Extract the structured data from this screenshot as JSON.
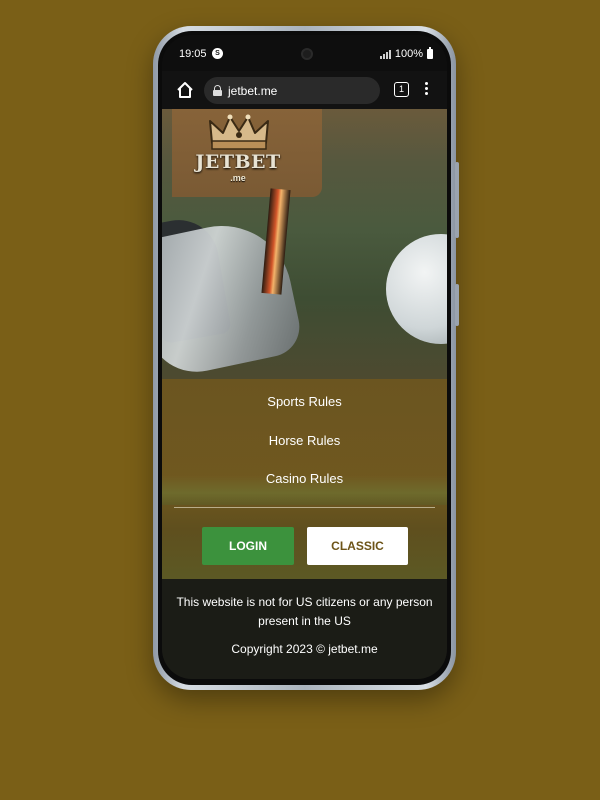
{
  "status_bar": {
    "time": "19:05",
    "notification_badge": "S",
    "battery_percent": "100%"
  },
  "browser": {
    "url": "jetbet.me",
    "tab_count": "1"
  },
  "logo": {
    "crown_text": "JETBET",
    "name": "JETBET",
    "suffix": ".me"
  },
  "menu": {
    "items": [
      {
        "label": "Sports Rules"
      },
      {
        "label": "Horse Rules"
      },
      {
        "label": "Casino Rules"
      }
    ]
  },
  "buttons": {
    "login": "LOGIN",
    "classic": "CLASSIC"
  },
  "footer": {
    "notice": "This website is not for US citizens or any person present in the US",
    "copyright": "Copyright 2023 © jetbet.me"
  },
  "colors": {
    "page_background": "#7a5f17",
    "login_button": "#3c923d",
    "classic_text": "#6d5418",
    "footer_background": "#1b1c16"
  },
  "icons": {
    "home": "home-icon",
    "lock": "lock-icon",
    "tabs": "tab-count-icon",
    "menu": "more-vert-icon",
    "crown": "crown-icon"
  }
}
